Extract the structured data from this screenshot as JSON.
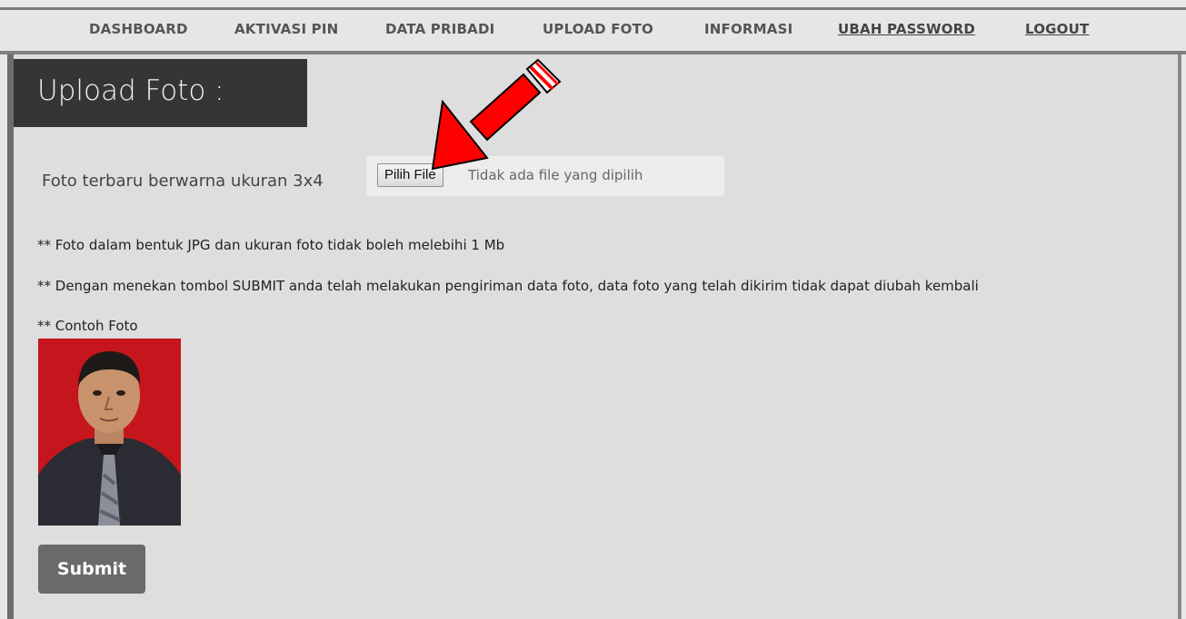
{
  "nav": {
    "items": [
      {
        "label": "DASHBOARD"
      },
      {
        "label": "AKTIVASI PIN"
      },
      {
        "label": "DATA PRIBADI"
      },
      {
        "label": "UPLOAD FOTO"
      },
      {
        "label": "INFORMASI"
      },
      {
        "label": "UBAH PASSWORD"
      },
      {
        "label": "LOGOUT"
      }
    ]
  },
  "page": {
    "title": "Upload Foto :"
  },
  "upload": {
    "label": "Foto terbaru berwarna ukuran 3x4",
    "button_label": "Pilih File",
    "status": "Tidak ada file yang dipilih"
  },
  "notes": {
    "format": "** Foto dalam bentuk JPG dan ukuran foto tidak boleh melebihi 1 Mb",
    "submit_info": "** Dengan menekan tombol SUBMIT anda telah melakukan pengiriman data foto, data foto yang telah dikirim tidak dapat diubah kembali",
    "example": "** Contoh Foto"
  },
  "form": {
    "submit_label": "Submit"
  },
  "colors": {
    "title_bg": "#353535",
    "photo_bg": "#c4161c",
    "arrow": "#ff0000",
    "submit_bg": "#6a6a6a"
  }
}
